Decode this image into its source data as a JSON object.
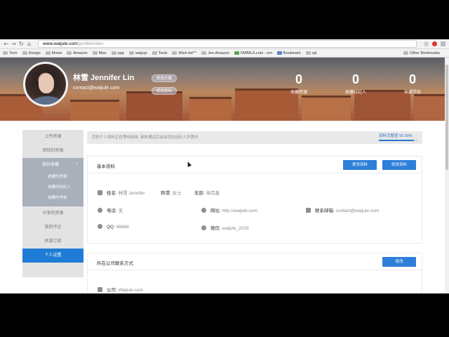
{
  "browser": {
    "url_host": "www.waijule.com",
    "url_path": "/profile/index",
    "bookmarks": [
      "Tech",
      "Design",
      "Movie",
      "Amazon",
      "Misc",
      "ppp",
      "waijuyi",
      "Tools",
      "Wish list^^",
      "Jon-Amazon",
      "NWMLS.com - em",
      "Bookmark",
      "wji"
    ],
    "other_bookmarks": "Other Bookmarks"
  },
  "profile": {
    "name": "林雪 Jennifer Lin",
    "email": "contact@waijule.com",
    "btn_edit_avatar": "修改头像",
    "btn_change_password": "修改密码"
  },
  "stats": [
    {
      "value": "0",
      "label": "收藏房源"
    },
    {
      "value": "0",
      "label": "收藏经纪人"
    },
    {
      "value": "0",
      "label": "收藏学校"
    }
  ],
  "sidebar": {
    "items": [
      {
        "label": "上传房源"
      },
      {
        "label": "审核的房源"
      }
    ],
    "group": {
      "label": "我的收藏",
      "chevron": "^"
    },
    "subitems": [
      {
        "label": "收藏的房源"
      },
      {
        "label": "收藏的经纪人"
      },
      {
        "label": "收藏的学校"
      }
    ],
    "items_after": [
      {
        "label": "分享的房源"
      },
      {
        "label": "我的评论"
      },
      {
        "label": "房源订阅"
      }
    ],
    "current": {
      "label": "个人设置"
    }
  },
  "notice": {
    "text": "您的个人资料正在等待审核, 审核通过后会出现在经纪人列表中",
    "completion_label": "资料完整度",
    "completion_value": "90.00%",
    "completion_fraction": 0.9
  },
  "basic_info": {
    "title": "基本资料",
    "btn_change_contact": "更改资料",
    "btn_edit": "修改资料",
    "name_label": "姓名:",
    "name_value": "林雪 Jennifer",
    "title_label": "称谓:",
    "title_value": "女士",
    "age_label": "年龄:",
    "age_value": "待完善",
    "phone_label": "电话:",
    "phone_value": "无",
    "website_label": "网址:",
    "website_value": "http://waijule.com",
    "email_label": "联系邮箱:",
    "email_value": "contact@waijule.com",
    "qq_label": "QQ:",
    "qq_value": "88888",
    "wechat_label": "微信:",
    "wechat_value": "waijule_2015"
  },
  "company": {
    "title": "所在公司联系方式",
    "btn_edit": "修改",
    "company_label": "公司:",
    "company_value": "Waijule.com"
  },
  "colors": {
    "accent": "#2e7fd9",
    "sidebar_active": "#1e7bd6",
    "sidebar_group": "#a8b0ba"
  }
}
